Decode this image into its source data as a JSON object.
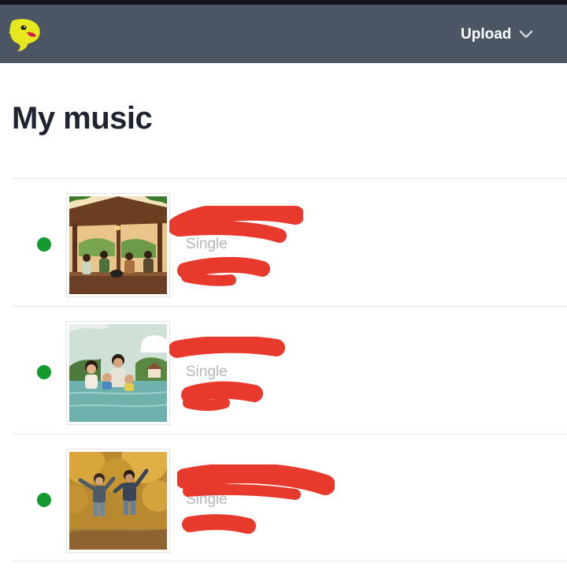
{
  "header": {
    "upload_label": "Upload",
    "background_color": "#4b5563",
    "logo_color": "#e4e81c"
  },
  "page": {
    "title": "My music"
  },
  "tracks": [
    {
      "title": "",
      "type": "Single",
      "artist": "",
      "status": "published",
      "status_color": "#139a2d",
      "cover": "porch-band-painting"
    },
    {
      "title": "",
      "type": "Single",
      "artist": "",
      "status": "published",
      "status_color": "#139a2d",
      "cover": "family-in-lake"
    },
    {
      "title": "",
      "type": "Single",
      "artist": "",
      "status": "published",
      "status_color": "#139a2d",
      "cover": "kids-jumping-autumn"
    }
  ]
}
